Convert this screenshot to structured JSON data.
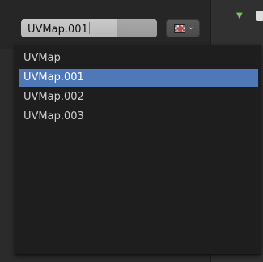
{
  "uv_name_field": {
    "value": "UVMap.001"
  },
  "browse_button": {
    "icon": "checker-texture-icon",
    "chevron": "⌄"
  },
  "panel": {
    "expand_icon": "▼"
  },
  "dropdown": {
    "items": [
      {
        "label": "UVMap",
        "selected": false
      },
      {
        "label": "UVMap.001",
        "selected": true
      },
      {
        "label": "UVMap.002",
        "selected": false
      },
      {
        "label": "UVMap.003",
        "selected": false
      }
    ]
  },
  "colors": {
    "selection": "#4f78b8",
    "menu_bg": "#1e1e1e",
    "accent_triangle": "#7ec356"
  }
}
